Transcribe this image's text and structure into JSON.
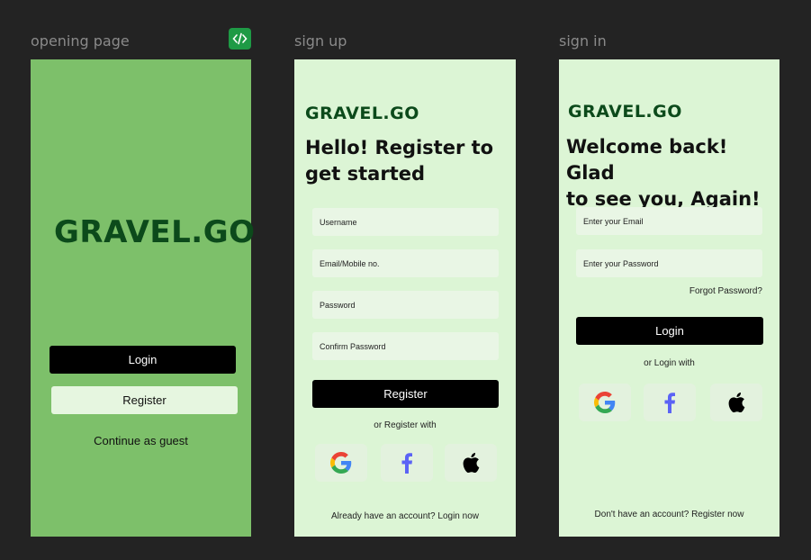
{
  "frames": {
    "opening": {
      "title": "opening page",
      "logo": "GRAVEL.GO",
      "login_label": "Login",
      "register_label": "Register",
      "guest_label": "Continue as guest"
    },
    "signup": {
      "title": "sign up",
      "logo": "GRAVEL.GO",
      "headline_line1": "Hello! Register to",
      "headline_line2": "get started",
      "fields": {
        "username": "Username",
        "email": "Email/Mobile no.",
        "password": "Password",
        "confirm": "Confirm Password"
      },
      "register_label": "Register",
      "or_label": "or Register with",
      "footer": "Already have an account? Login now"
    },
    "signin": {
      "title": "sign in",
      "logo": "GRAVEL.GO",
      "headline_line1": "Welcome back! Glad",
      "headline_line2": "to see you, Again!",
      "fields": {
        "email": "Enter your Email",
        "password": "Enter your Password"
      },
      "forgot_label": "Forgot Password?",
      "login_label": "Login",
      "or_label": "or Login with",
      "footer": "Don't have an account? Register now"
    }
  },
  "icons": {
    "dev_mode": "code-icon",
    "google": "google-icon",
    "facebook": "facebook-icon",
    "apple": "apple-icon"
  },
  "colors": {
    "canvas": "#232323",
    "opening_bg": "#7dc06a",
    "form_bg": "#dcf5d5",
    "logo": "#0c4a1b",
    "facebook": "#5b63f5",
    "dev_badge": "#1e9a45"
  }
}
